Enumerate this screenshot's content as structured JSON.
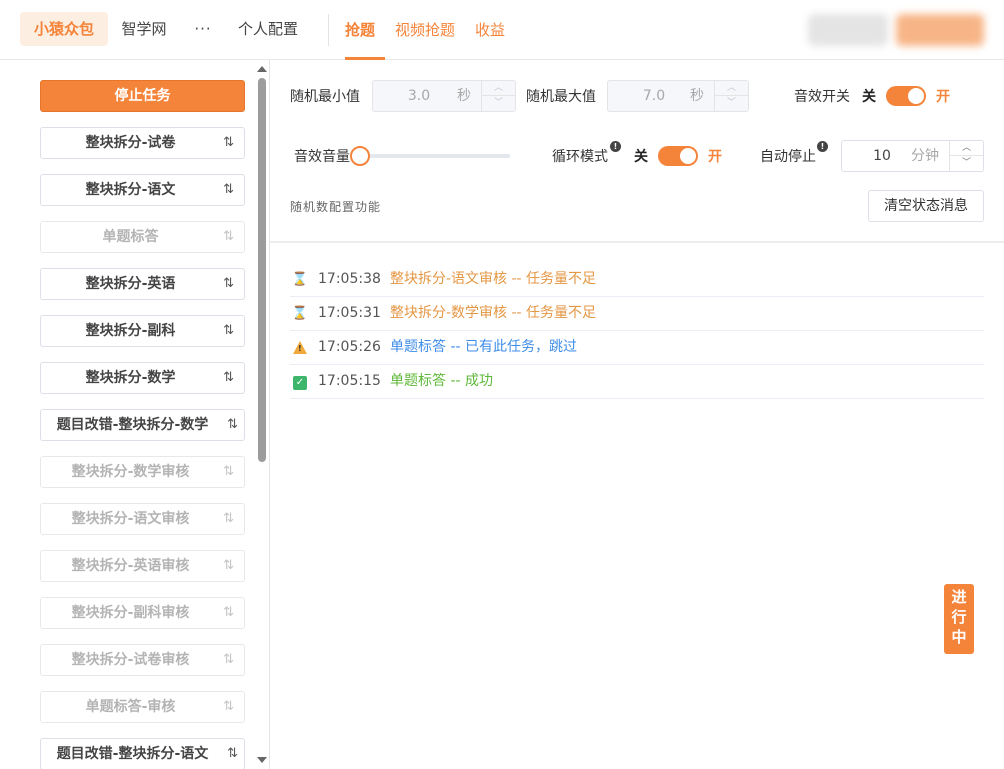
{
  "apps": [
    {
      "label": "小猿众包",
      "active": true
    },
    {
      "label": "智学网",
      "active": false
    }
  ],
  "more_label": "···",
  "profile_label": "个人配置",
  "tabs": [
    {
      "label": "抢题",
      "active": true
    },
    {
      "label": "视频抢题",
      "active": false
    },
    {
      "label": "收益",
      "active": false
    }
  ],
  "sidebar": {
    "stop_label": "停止任务",
    "tasks": [
      {
        "label": "整块拆分-试卷",
        "disabled": false
      },
      {
        "label": "整块拆分-语文",
        "disabled": false
      },
      {
        "label": "单题标答",
        "disabled": true
      },
      {
        "label": "整块拆分-英语",
        "disabled": false
      },
      {
        "label": "整块拆分-副科",
        "disabled": false
      },
      {
        "label": "整块拆分-数学",
        "disabled": false
      },
      {
        "label": "题目改错-整块拆分-数学",
        "disabled": false
      },
      {
        "label": "整块拆分-数学审核",
        "disabled": true
      },
      {
        "label": "整块拆分-语文审核",
        "disabled": true
      },
      {
        "label": "整块拆分-英语审核",
        "disabled": true
      },
      {
        "label": "整块拆分-副科审核",
        "disabled": true
      },
      {
        "label": "整块拆分-试卷审核",
        "disabled": true
      },
      {
        "label": "单题标答-审核",
        "disabled": true
      },
      {
        "label": "题目改错-整块拆分-语文",
        "disabled": false
      }
    ],
    "sort_icon": "sort-icon"
  },
  "settings": {
    "random_min_label": "随机最小值",
    "random_min_value": "3.0",
    "random_min_unit": "秒",
    "random_max_label": "随机最大值",
    "random_max_value": "7.0",
    "random_max_unit": "秒",
    "sound_switch_label": "音效开关",
    "volume_label": "音效音量",
    "volume_level": 0,
    "loop_label": "循环模式",
    "auto_stop_label": "自动停止",
    "auto_stop_value": "10",
    "auto_stop_unit": "分钟",
    "off_label": "关",
    "on_label": "开",
    "hint": "随机数配置功能",
    "clear_label": "清空状态消息"
  },
  "logs": [
    {
      "icon": "hourglass-icon",
      "time": "17:05:38",
      "message": "整块拆分-语文审核 -- 任务量不足",
      "color": "#e49744"
    },
    {
      "icon": "hourglass-icon",
      "time": "17:05:31",
      "message": "整块拆分-数学审核 -- 任务量不足",
      "color": "#e49744"
    },
    {
      "icon": "warning-icon",
      "time": "17:05:26",
      "message": "单题标答 -- 已有此任务，跳过",
      "color": "#3f8ee8"
    },
    {
      "icon": "check-icon",
      "time": "17:05:15",
      "message": "单题标答 -- 成功",
      "color": "#5fb839"
    }
  ],
  "status_tag": "进行中",
  "colors": {
    "accent": "#f5843b"
  }
}
